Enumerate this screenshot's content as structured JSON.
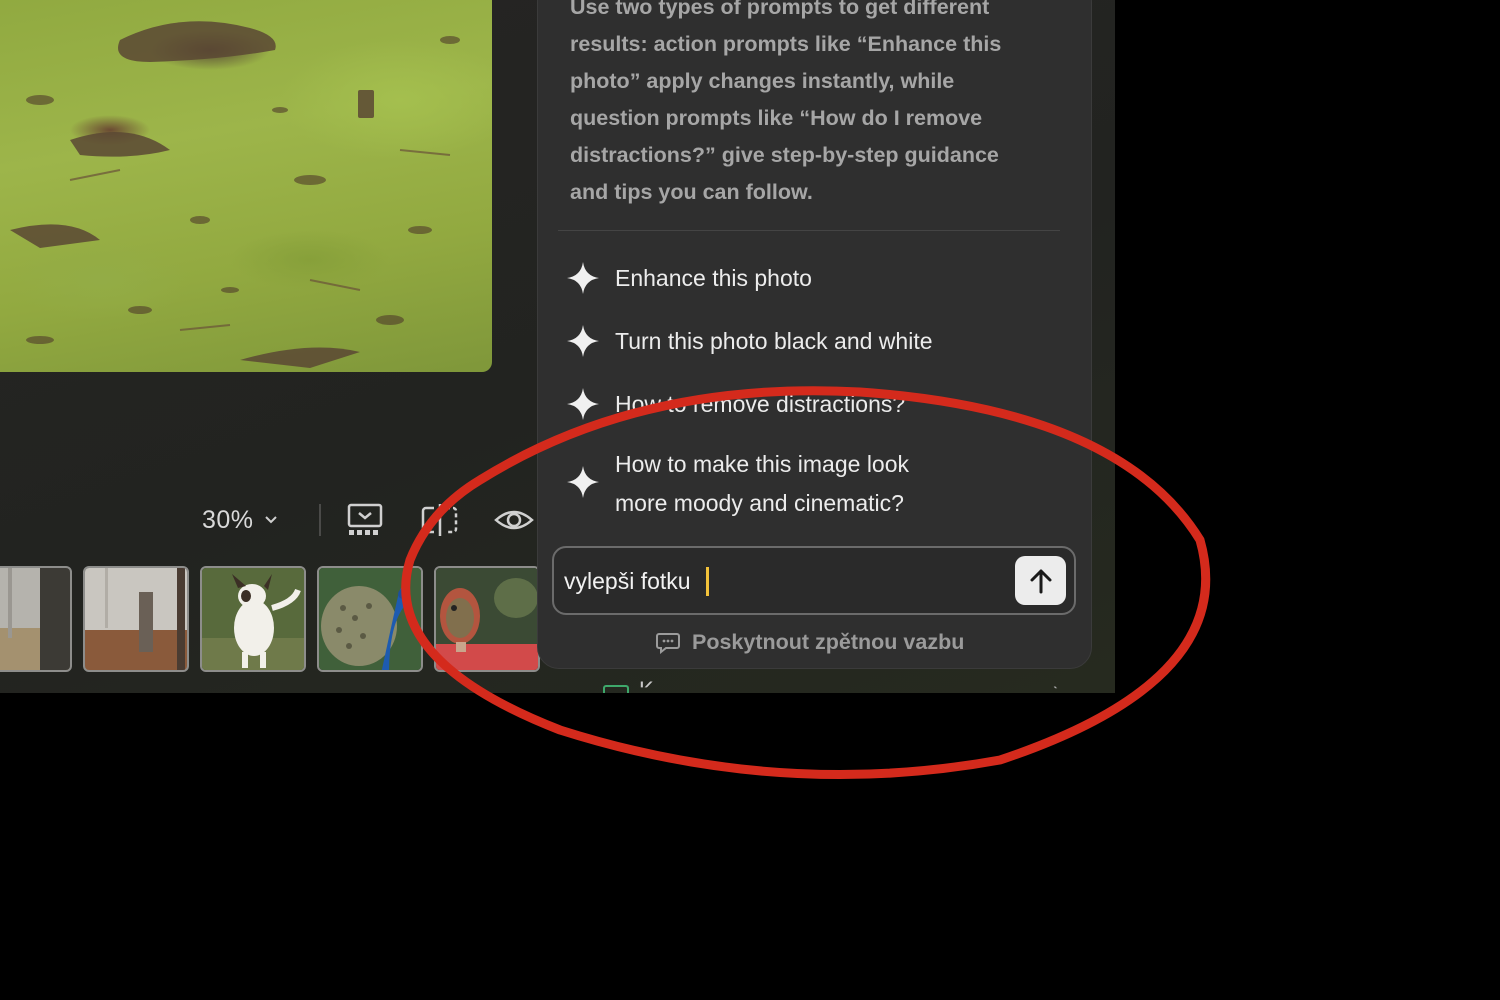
{
  "toolbar": {
    "zoom_value": "30%",
    "zoom_icon": "chevron-down-icon",
    "icons": [
      "filmstrip-icon",
      "compare-icon",
      "eye-icon"
    ]
  },
  "filmstrip": {
    "thumbnails": [
      "forest-trunk",
      "foggy-forest",
      "dog",
      "peacock",
      "bird-figurine"
    ]
  },
  "assistant": {
    "intro_text": "Use two types of prompts to get different results: action prompts like “Enhance this photo” apply changes instantly, while question prompts like “How do I remove distractions?” give step-by-step guidance and tips you can follow.",
    "suggestions": [
      {
        "label": "Enhance this photo",
        "icon": "sparkle-icon"
      },
      {
        "label": "Turn this photo black and white",
        "icon": "sparkle-icon"
      },
      {
        "label": "How to remove distractions?",
        "icon": "sparkle-icon"
      },
      {
        "label": "How to make this image look\nmore moody and cinematic?",
        "icon": "sparkle-icon"
      }
    ],
    "input_value": "vylepši fotku",
    "send_icon": "arrow-up-icon",
    "feedback_label": "Poskytnout zpětnou vazbu",
    "feedback_icon": "chat-bubble-icon"
  },
  "below_panel": {
    "partial_text": "K...",
    "icon": "panel-icon"
  },
  "annotation": {
    "type": "red-ellipse",
    "color": "#d42a1c"
  }
}
